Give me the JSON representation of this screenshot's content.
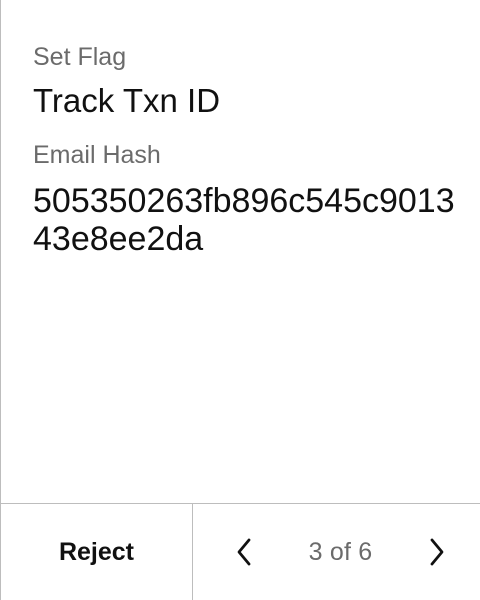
{
  "details": {
    "set_flag_label": "Set Flag",
    "set_flag_value": "Track Txn ID",
    "email_hash_label": "Email Hash",
    "email_hash_value": "505350263fb896c545c901343e8ee2da"
  },
  "footer": {
    "reject_label": "Reject",
    "page_indicator": "3 of 6",
    "prev_icon": "chevron-left-icon",
    "next_icon": "chevron-right-icon"
  },
  "colors": {
    "text": "#111111",
    "muted": "#6b6b6b",
    "border": "#bdbdbd",
    "background": "#ffffff"
  }
}
